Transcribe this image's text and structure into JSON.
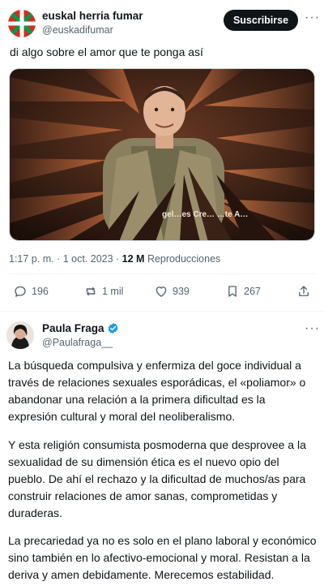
{
  "tweet1": {
    "display_name": "euskal herria fumar",
    "handle": "@euskadifumar",
    "subscribe_label": "Suscribirse",
    "more_label": "···",
    "text": "di algo sobre el amor que te ponga así",
    "media": {
      "caption": "gel…es Cre… …te A…"
    },
    "time": "1:17 p. m.",
    "date": "1 oct. 2023",
    "sep1": " · ",
    "sep2": " · ",
    "views_count": "12 M",
    "views_label": "Reproducciones",
    "actions": {
      "replies": "196",
      "retweets": "1 mil",
      "likes": "939",
      "bookmarks": "267"
    },
    "colors": {
      "subscribe_bg": "#0f1419",
      "flag_red": "#d52b1e",
      "flag_green": "#009b48"
    }
  },
  "tweet2": {
    "display_name": "Paula Fraga",
    "handle": "@Paulafraga__",
    "more_label": "···",
    "paragraphs": [
      "La búsqueda compulsiva y enfermiza del goce individual a través de relaciones sexuales esporádicas, el «poliamor» o abandonar una relación a la primera dificultad es la expresión cultural y moral del neoliberalismo.",
      "Y esta religión consumista posmoderna que desprovee a la sexualidad de su dimensión ética es el nuevo opio del pueblo. De ahí el rechazo y la dificultad de muchos/as para construir relaciones de amor sanas, comprometidas y duraderas.",
      "La precariedad ya no es solo en el plano laboral y económico sino también en lo afectivo-emocional y moral. Resistan a la deriva y amen debidamente. Merecemos estabilidad."
    ],
    "colors": {
      "verified": "#1d9bf0"
    }
  }
}
